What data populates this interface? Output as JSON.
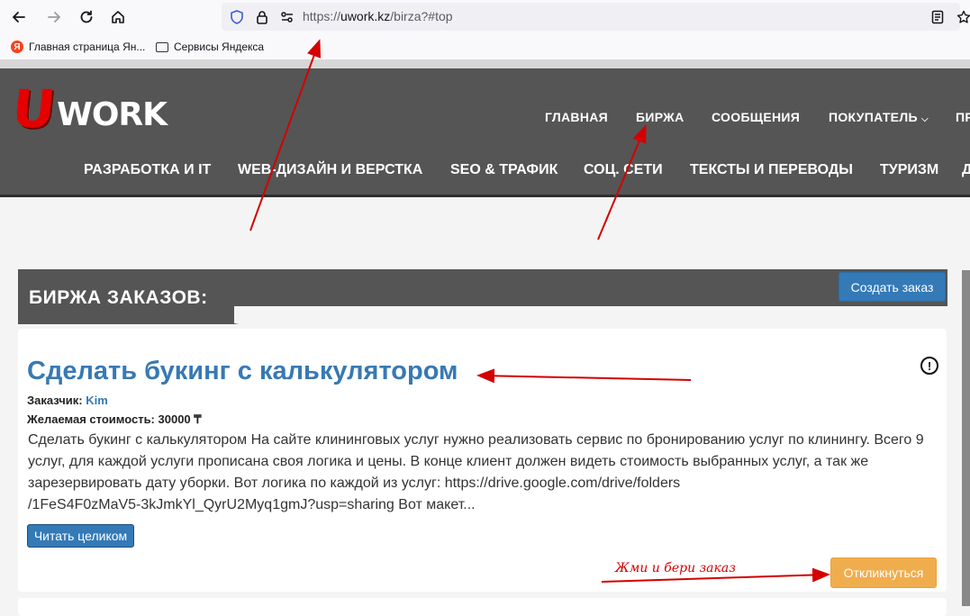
{
  "browser": {
    "url_scheme": "https://",
    "url_host": "uwork.kz",
    "url_path": "/birza?#top",
    "bookmarks": [
      {
        "label": "Главная страница Ян...",
        "icon": "yandex-icon"
      },
      {
        "label": "Сервисы Яндекса",
        "icon": "folder-icon"
      }
    ]
  },
  "site": {
    "logo": {
      "letter": "U",
      "rest": "WORK"
    },
    "topnav": [
      "ГЛАВНАЯ",
      "БИРЖА",
      "СООБЩЕНИЯ",
      "ПОКУПАТЕЛЬ",
      "ПР"
    ],
    "categories": [
      "РАЗРАБОТКА И IT",
      "WEB-ДИЗАЙН И ВЕРСТКА",
      "SEO & ТРАФИК",
      "СОЦ. СЕТИ",
      "ТЕКСТЫ И ПЕРЕВОДЫ",
      "ТУРИЗМ",
      "Д"
    ]
  },
  "main": {
    "section_title": "БИРЖА ЗАКАЗОВ:",
    "create_button": "Создать заказ",
    "order": {
      "title": "Сделать букинг с калькулятором",
      "customer_label": "Заказчик:",
      "customer_name": "Kim",
      "price_label": "Желаемая стоимость:",
      "price_value": "30000 ₸",
      "description_lines": [
        "Сделать букинг с калькулятором На сайте клининговых услуг нужно реализовать сервис по бронированию услуг по клинингу. Всего 9",
        "услуг, для каждой услуги прописана своя логика и цены. В конце клиент должен видеть стоимость выбранных услуг, а так же",
        "зарезервировать дату уборки. Вот логика по каждой из услуг: https://drive.google.com/drive/folders",
        "/1FeS4F0zMaV5-3kJmkYl_QyrU2Myq1gmJ?usp=sharing Вот макет..."
      ],
      "read_more_button": "Читать целиком",
      "respond_button": "Откликнуться",
      "info_symbol": "!"
    },
    "annotation_text": "Жми и бери заказ"
  },
  "colors": {
    "header_bg": "#555555",
    "link_blue": "#3779b3",
    "primary_btn": "#337ab7",
    "warning_btn": "#f0ad4e",
    "annotation_red": "#d40000",
    "logo_red": "#e60000"
  }
}
